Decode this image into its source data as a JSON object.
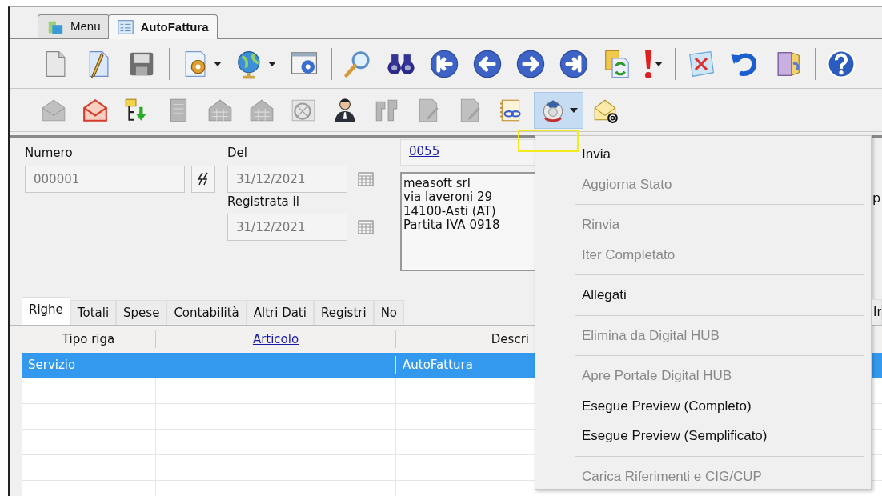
{
  "window_tabs": [
    {
      "label": "Menu",
      "selected": false
    },
    {
      "label": "AutoFattura",
      "selected": true
    }
  ],
  "toolbar_1": [
    {
      "kind": "button",
      "disabled": false,
      "pressed": false
    },
    {
      "kind": "button",
      "disabled": false,
      "pressed": false
    },
    {
      "kind": "button",
      "disabled": false,
      "pressed": false
    },
    {
      "kind": "separator"
    },
    {
      "kind": "dropdown",
      "disabled": false,
      "pressed": false
    },
    {
      "kind": "dropdown",
      "disabled": false,
      "pressed": false
    },
    {
      "kind": "button",
      "disabled": false,
      "pressed": false
    },
    {
      "kind": "separator"
    },
    {
      "kind": "button",
      "disabled": false,
      "pressed": false
    },
    {
      "kind": "button",
      "disabled": false,
      "pressed": false
    },
    {
      "kind": "button",
      "disabled": false,
      "pressed": false
    },
    {
      "kind": "button",
      "disabled": false,
      "pressed": false
    },
    {
      "kind": "button",
      "disabled": false,
      "pressed": false
    },
    {
      "kind": "button",
      "disabled": false,
      "pressed": false
    },
    {
      "kind": "button",
      "disabled": false,
      "pressed": false
    },
    {
      "kind": "dropdown",
      "disabled": false,
      "pressed": false
    },
    {
      "kind": "separator"
    },
    {
      "kind": "button",
      "disabled": false,
      "pressed": false
    },
    {
      "kind": "button",
      "disabled": false,
      "pressed": false
    },
    {
      "kind": "button",
      "disabled": false,
      "pressed": false
    },
    {
      "kind": "separator"
    },
    {
      "kind": "button",
      "disabled": false,
      "pressed": false
    }
  ],
  "toolbar_2": [
    {
      "kind": "button",
      "disabled": true,
      "pressed": false
    },
    {
      "kind": "button",
      "disabled": false,
      "pressed": false
    },
    {
      "kind": "button",
      "disabled": false,
      "pressed": false
    },
    {
      "kind": "button",
      "disabled": true,
      "pressed": false
    },
    {
      "kind": "button",
      "disabled": true,
      "pressed": false
    },
    {
      "kind": "button",
      "disabled": true,
      "pressed": false
    },
    {
      "kind": "button",
      "disabled": true,
      "pressed": false
    },
    {
      "kind": "button",
      "disabled": false,
      "pressed": false
    },
    {
      "kind": "button",
      "disabled": true,
      "pressed": false
    },
    {
      "kind": "button",
      "disabled": true,
      "pressed": false
    },
    {
      "kind": "button",
      "disabled": true,
      "pressed": false
    },
    {
      "kind": "button",
      "disabled": false,
      "pressed": false
    },
    {
      "kind": "dropdown",
      "disabled": false,
      "pressed": true
    },
    {
      "kind": "button",
      "disabled": false,
      "pressed": false
    }
  ],
  "form": {
    "numero": {
      "label": "Numero",
      "value": "000001",
      "disabled": true
    },
    "del": {
      "label": "Del",
      "value": "31/12/2021",
      "disabled": true
    },
    "registrata": {
      "label": "Registrata il",
      "value": "31/12/2021",
      "disabled": true
    },
    "code_link": "0055",
    "address_lines": [
      "measoft srl",
      "via laveroni 29",
      "14100-Asti (AT)",
      "Partita IVA 0918"
    ],
    "cut_label": "p"
  },
  "detail_tabs": [
    {
      "label": "Righe",
      "selected": true
    },
    {
      "label": "Totali",
      "selected": false
    },
    {
      "label": "Spese",
      "selected": false
    },
    {
      "label": "Contabilità",
      "selected": false
    },
    {
      "label": "Altri Dati",
      "selected": false
    },
    {
      "label": "Registri",
      "selected": false
    },
    {
      "label": "No",
      "selected": false
    },
    {
      "label": "Ir",
      "selected": false
    }
  ],
  "grid": {
    "columns": [
      {
        "label": "Tipo riga",
        "link": false
      },
      {
        "label": "Articolo",
        "link": true
      },
      {
        "label": "Descri",
        "link": false
      }
    ],
    "rows": [
      {
        "cells": [
          "Servizio",
          "",
          "AutoFattura"
        ],
        "selected": true
      }
    ]
  },
  "menu": {
    "items": [
      {
        "kind": "item",
        "label": "Invia",
        "disabled": false
      },
      {
        "kind": "item",
        "label": "Aggiorna Stato",
        "disabled": true
      },
      {
        "kind": "separator"
      },
      {
        "kind": "item",
        "label": "Rinvia",
        "disabled": true
      },
      {
        "kind": "item",
        "label": "Iter Completato",
        "disabled": true
      },
      {
        "kind": "separator"
      },
      {
        "kind": "item",
        "label": "Allegati",
        "disabled": false
      },
      {
        "kind": "separator"
      },
      {
        "kind": "item",
        "label": "Elimina da Digital HUB",
        "disabled": true
      },
      {
        "kind": "separator"
      },
      {
        "kind": "item",
        "label": "Apre Portale Digital HUB",
        "disabled": true
      },
      {
        "kind": "item",
        "label": "Esegue Preview (Completo)",
        "disabled": false
      },
      {
        "kind": "item",
        "label": "Esegue Preview (Semplificato)",
        "disabled": false
      },
      {
        "kind": "separator"
      },
      {
        "kind": "item",
        "label": "Carica Riferimenti e CIG/CUP",
        "disabled": true
      }
    ]
  }
}
